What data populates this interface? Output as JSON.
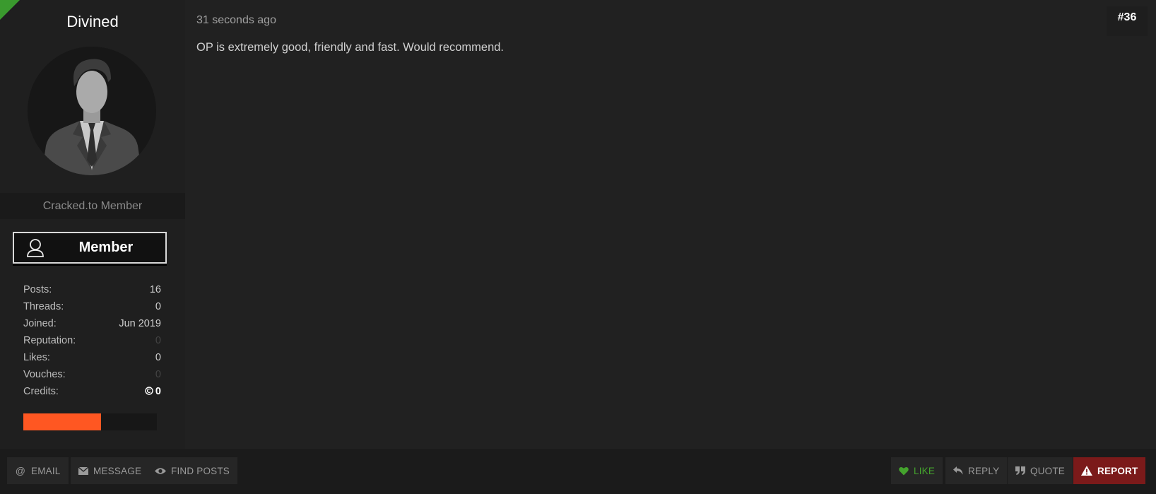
{
  "user": {
    "username": "Divined",
    "usertitle": "Cracked.to Member",
    "rank_label": "Member",
    "stats": [
      {
        "label": "Posts:",
        "value": "16"
      },
      {
        "label": "Threads:",
        "value": "0"
      },
      {
        "label": "Joined:",
        "value": "Jun 2019"
      },
      {
        "label": "Reputation:",
        "value": "0"
      },
      {
        "label": "Likes:",
        "value": "0"
      },
      {
        "label": "Vouches:",
        "value": "0"
      },
      {
        "label": "Credits:",
        "value": "0"
      }
    ],
    "progress_fraction": 0.58
  },
  "post": {
    "date": "31 seconds ago",
    "number": "#36",
    "message": "OP is extremely good, friendly and fast. Would recommend."
  },
  "footer": {
    "email_label": "EMAIL",
    "message_label": "MESSAGE",
    "find_posts_label": "FIND POSTS",
    "like_label": "LIKE",
    "reply_label": "REPLY",
    "quote_label": "QUOTE",
    "report_label": "REPORT"
  },
  "colors": {
    "accent_green": "#3a9a2e",
    "progress_orange": "#ff5722",
    "report_red": "#7b1a1a"
  }
}
